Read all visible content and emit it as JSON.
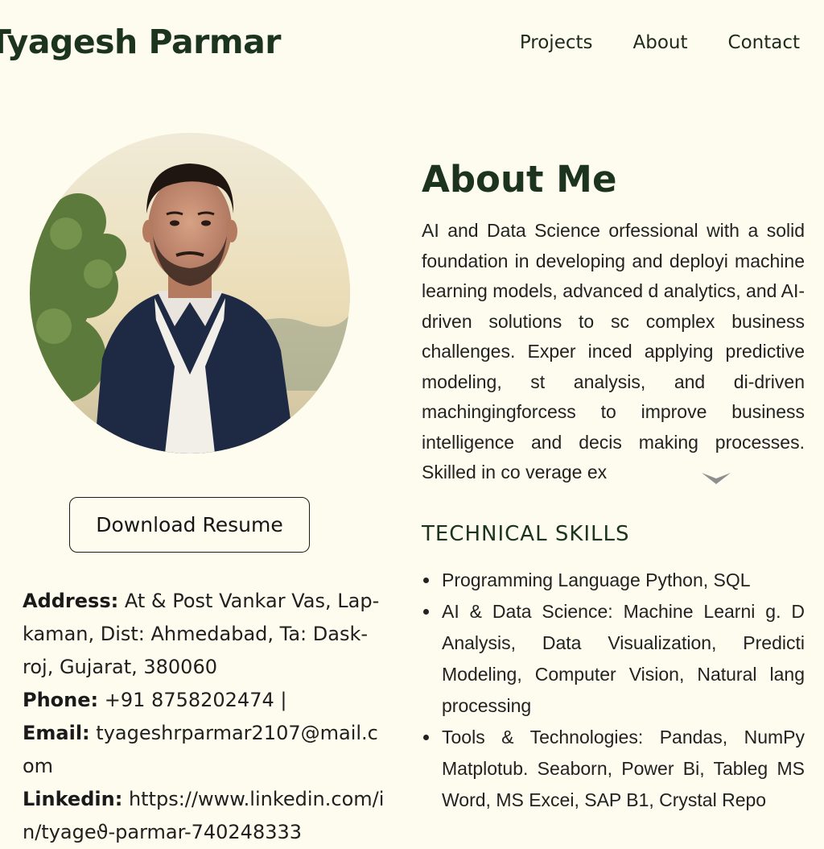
{
  "header": {
    "site_name": "Tyagesh Parmar",
    "nav": [
      "Projects",
      "About",
      "Contact"
    ]
  },
  "profile": {
    "photo_icon": "portrait-photo",
    "resume_button": "Download Resume"
  },
  "contact": {
    "address_label": "Address:",
    "address_value": "At & Post Vankar Vas, Lap-kaman, Dist: Ahmedabad, Ta: Dask-roj, Gujarat, 380060",
    "phone_label": "Phone:",
    "phone_value": "+91 8758202474 |",
    "email_label": "Email:",
    "email_value": "tyageshrparmar2107@mail.com",
    "linkedin_label": "Linkedin:",
    "linkedin_value": "https://www.linkedin.com/in/tyageϑ-parmar-740248333"
  },
  "about": {
    "heading": "About Me",
    "text": "AI and Data Science orfessional with a solid foundation in developing and deployi machine learning models, advanced d analytics, and AI-driven solutions to sc complex business challenges. Exper inced applying predictive modeling, st analysis, and di-driven machingingforcess to improve business intelligence and decis making processes. Skilled in co verage ex"
  },
  "skills": {
    "heading": "TECHNICAL SKILLS",
    "items": [
      "Programming Language Python, SQL",
      "AI & Data Science: Machine Learni g. D Analysis, Data Visualization, Predicti Modeling, Computer Vision, Natural lang processing",
      "Tools & Technologies: Pandas, NumPy Matplotub. Seaborn, Power Bi, Tableg MS Word, MS Excei, SAP B1, Crystal Repo"
    ]
  },
  "colors": {
    "background": "#fdfcee",
    "heading": "#1c3320",
    "text": "#222222"
  }
}
